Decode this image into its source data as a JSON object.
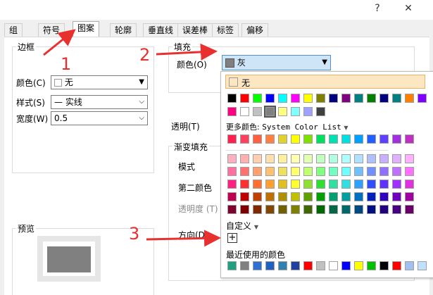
{
  "window": {
    "help_label": "?",
    "close_label": "✕"
  },
  "tabs": [
    {
      "label": "组"
    },
    {
      "label": "符号"
    },
    {
      "label": "图案"
    },
    {
      "label": "轮廓"
    },
    {
      "label": "垂直线"
    },
    {
      "label": "误差棒"
    },
    {
      "label": "标签"
    },
    {
      "label": "偏移"
    }
  ],
  "border": {
    "title": "边框",
    "color_label": "颜色(C)",
    "color_value": "无",
    "style_label": "样式(S)",
    "style_value": "— 实线",
    "width_label": "宽度(W)",
    "width_value": "0.5"
  },
  "fill": {
    "title": "填充",
    "color_label": "颜色(O)",
    "color_value": "灰",
    "color_swatch": "#808080"
  },
  "transparency_label": "透明(T)",
  "gradient": {
    "title": "渐变填充",
    "mode_label": "模式",
    "second_color_label": "第二颜色",
    "opacity_label": "透明度 (T)",
    "direction_label": "方向(D)"
  },
  "preview": {
    "title": "预览",
    "fill": "#808080"
  },
  "popup": {
    "none_label": "无",
    "more_colors_label": "更多颜色:",
    "more_colors_value": "System Color List",
    "custom_label": "自定义",
    "add_label": "+",
    "recent_label": "最近使用的颜色",
    "basic_row1": [
      "#000000",
      "#ff0000",
      "#00ff00",
      "#0000ff",
      "#00ffff",
      "#ff00ff",
      "#ffff00",
      "#808000",
      "#000080",
      "#800080",
      "#008080",
      "#008000",
      "#000080",
      "#008080",
      "#ff8000",
      "#8000ff"
    ],
    "basic_row2": [
      "#ff0080",
      "#ffffff",
      "#c0c0c0",
      "#808080",
      "#ffff80",
      "#80ffff",
      "#a0a0ff",
      "#404040"
    ],
    "more_row": [
      "#ff2050",
      "#ff4060",
      "#ff6040",
      "#ff8040",
      "#e0d030",
      "#ffff00",
      "#80e000",
      "#00e060",
      "#00e0b0",
      "#00e0e0",
      "#00a0ff",
      "#2060ff",
      "#6040ff",
      "#a030e0",
      "#c030c0"
    ],
    "grid": [
      [
        "#ffb0c0",
        "#ffb0b0",
        "#ffd0b0",
        "#ffe0b0",
        "#fff0a0",
        "#ffffb0",
        "#e0ffb0",
        "#c0ffc0",
        "#b0ffe0",
        "#b0ffff",
        "#b0e0ff",
        "#b0c0ff",
        "#c8b0ff",
        "#e0b0ff",
        "#ffb0ff"
      ],
      [
        "#ff70a0",
        "#ff7070",
        "#ffa070",
        "#ffc070",
        "#f0e060",
        "#ffff70",
        "#c0ff70",
        "#80ff80",
        "#70ffc0",
        "#70ffff",
        "#70c0ff",
        "#7090ff",
        "#9070ff",
        "#c070ff",
        "#ff70ff"
      ],
      [
        "#ff2080",
        "#ff3030",
        "#ff7030",
        "#ffa030",
        "#e0c020",
        "#ffff30",
        "#90e030",
        "#30e030",
        "#30e0a0",
        "#30e0e0",
        "#30a0ff",
        "#3050ff",
        "#6030ff",
        "#a030ff",
        "#e030e0"
      ],
      [
        "#c00050",
        "#c00000",
        "#c04000",
        "#c07000",
        "#b09000",
        "#c0c000",
        "#60a000",
        "#00a000",
        "#00a070",
        "#00a0a0",
        "#0070c0",
        "#0020c0",
        "#3000c0",
        "#7000c0",
        "#a000a0"
      ],
      [
        "#800030",
        "#800000",
        "#802800",
        "#804800",
        "#706000",
        "#808000",
        "#406800",
        "#006800",
        "#006848",
        "#006868",
        "#004880",
        "#001080",
        "#200080",
        "#480080",
        "#680068"
      ]
    ],
    "recent": [
      "#20a080",
      "#808080",
      "#3070d0",
      "#2060c0",
      "#3080b0",
      "#2040a0",
      "#ff0000",
      "#c0c0c0",
      "#ffffff",
      "#0000ff",
      "#ffff00",
      "#00c000",
      "#000000",
      "#ff0000",
      "#a0c0f0",
      "#c0e0ff"
    ]
  },
  "annotations": [
    "1",
    "2",
    "3"
  ]
}
